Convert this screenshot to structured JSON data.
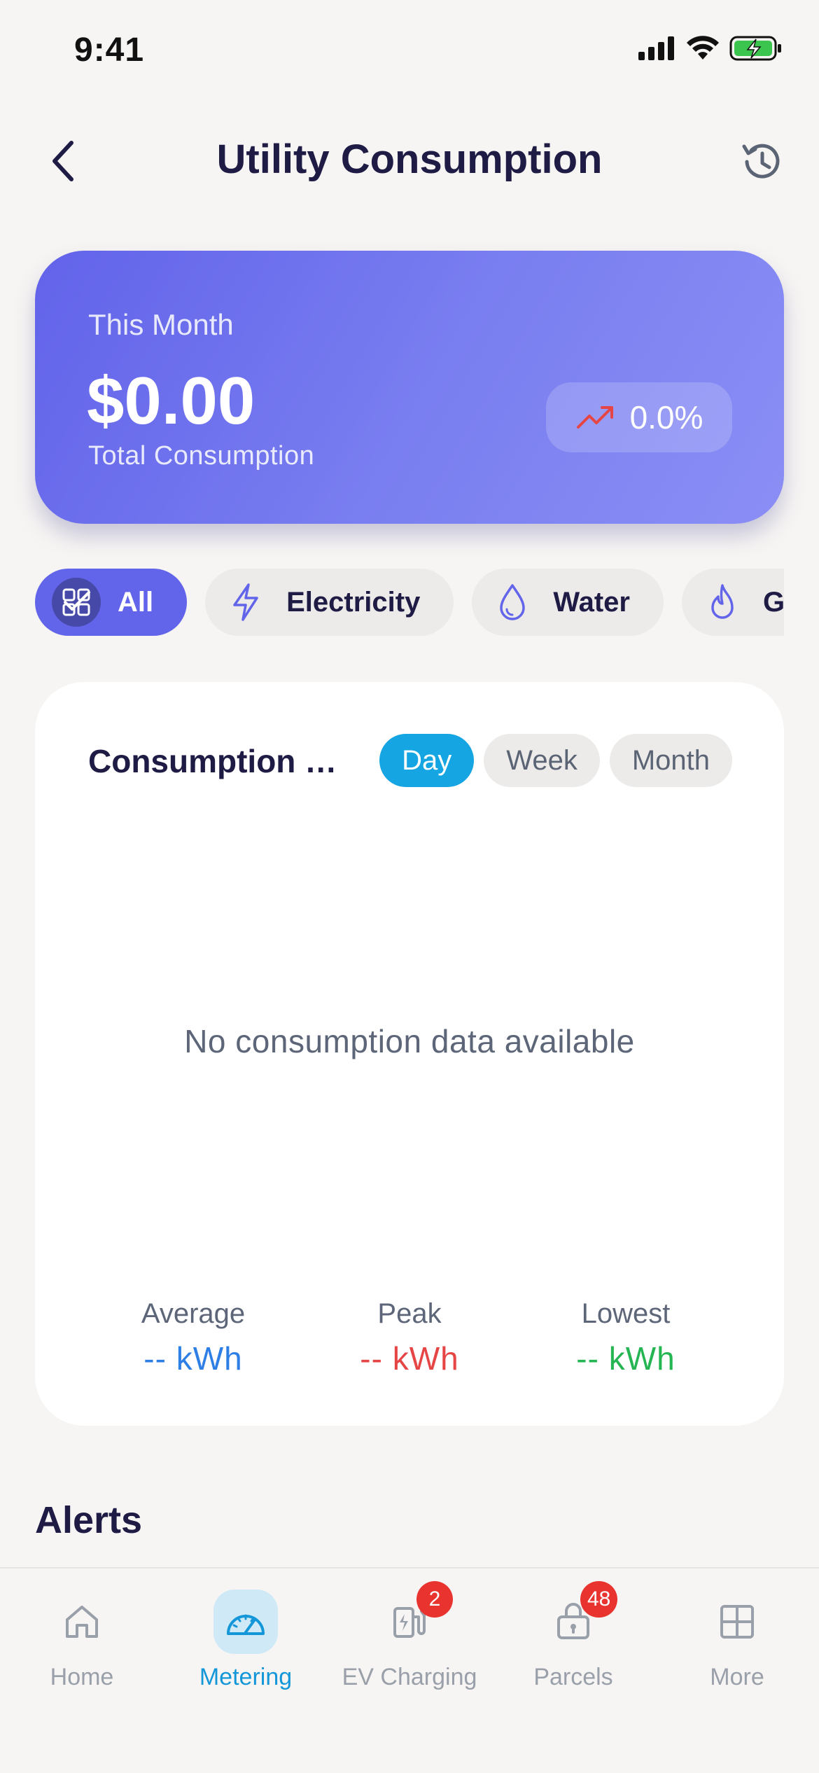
{
  "status_bar": {
    "time": "9:41"
  },
  "header": {
    "title": "Utility Consumption"
  },
  "summary": {
    "period": "This Month",
    "amount": "$0.00",
    "subtitle": "Total Consumption",
    "trend": "0.0%",
    "trend_color": "#e64545"
  },
  "categories": [
    {
      "label": "All",
      "icon": "grid-check-icon",
      "active": true
    },
    {
      "label": "Electricity",
      "icon": "lightning-icon",
      "active": false
    },
    {
      "label": "Water",
      "icon": "water-drop-icon",
      "active": false
    },
    {
      "label": "Gas",
      "icon": "flame-icon",
      "active": false
    }
  ],
  "trend_card": {
    "title": "Consumption Trends",
    "ranges": [
      {
        "label": "Day",
        "active": true
      },
      {
        "label": "Week",
        "active": false
      },
      {
        "label": "Month",
        "active": false
      }
    ],
    "empty_message": "No consumption data available",
    "stats": [
      {
        "label": "Average",
        "value": "-- kWh",
        "color": "#2d7fe6"
      },
      {
        "label": "Peak",
        "value": "-- kWh",
        "color": "#e64545"
      },
      {
        "label": "Lowest",
        "value": "-- kWh",
        "color": "#26b553"
      }
    ]
  },
  "alerts": {
    "heading": "Alerts"
  },
  "tab_bar": {
    "tabs": [
      {
        "label": "Home",
        "icon": "home-icon",
        "active": false,
        "badge": null
      },
      {
        "label": "Metering",
        "icon": "gauge-icon",
        "active": true,
        "badge": null
      },
      {
        "label": "EV Charging",
        "icon": "ev-charger-icon",
        "active": false,
        "badge": "2"
      },
      {
        "label": "Parcels",
        "icon": "parcel-locker-icon",
        "active": false,
        "badge": "48"
      },
      {
        "label": "More",
        "icon": "grid-icon",
        "active": false,
        "badge": null
      }
    ]
  },
  "colors": {
    "accent": "#6264ea",
    "range_active": "#15a5e3",
    "tab_active": "#1497d8",
    "badge": "#e8332f"
  }
}
